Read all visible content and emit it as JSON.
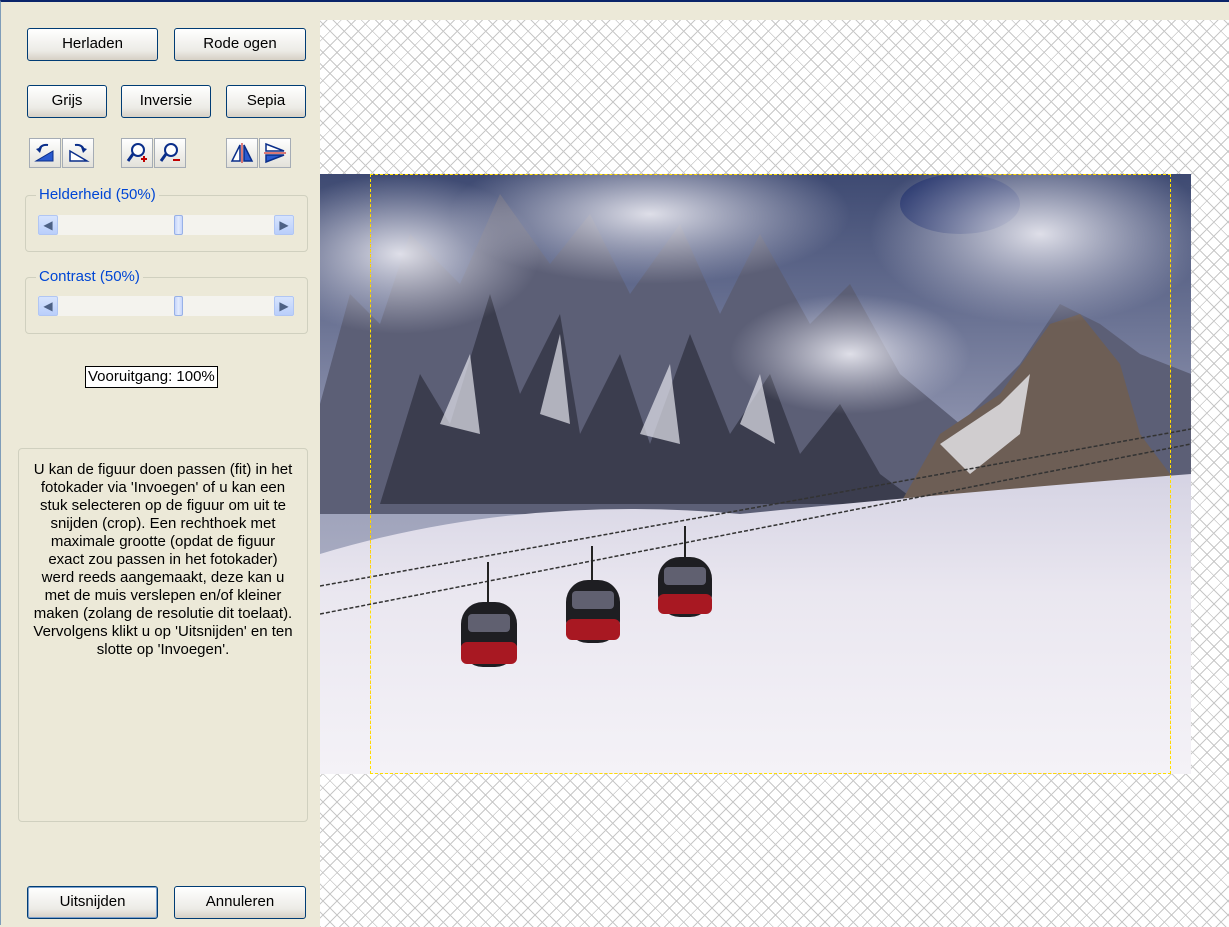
{
  "toolbar": {
    "reload_label": "Herladen",
    "red_eye_label": "Rode ogen",
    "gray_label": "Grijs",
    "invert_label": "Inversie",
    "sepia_label": "Sepia",
    "icons": [
      "rotate-left-icon",
      "rotate-right-icon",
      "zoom-in-icon",
      "zoom-out-icon",
      "flip-horizontal-icon",
      "flip-vertical-icon"
    ]
  },
  "brightness": {
    "label": "Helderheid (50%)",
    "value_percent": 50
  },
  "contrast": {
    "label": "Contrast (50%)",
    "value_percent": 50
  },
  "progress": {
    "label": "Vooruitgang: 100%",
    "value_percent": 100
  },
  "info": {
    "text": "U kan de figuur doen passen (fit) in het fotokader via 'Invoegen' of u kan een stuk selecteren op de figuur om uit te snijden (crop). Een rechthoek met maximale grootte (opdat de figuur exact zou passen in het fotokader) werd reeds aangemaakt, deze kan u met de muis verslepen en/of kleiner maken (zolang de resolutie dit toelaat). Vervolgens klikt u op 'Uitsnijden' en ten slotte op 'Invoegen'."
  },
  "footer": {
    "crop_label": "Uitsnijden",
    "cancel_label": "Annuleren"
  },
  "colors": {
    "accent": "#0046D5",
    "button_border": "#003C74",
    "crop_line_outer": "#E00000",
    "crop_line_inner": "#FFE000"
  }
}
